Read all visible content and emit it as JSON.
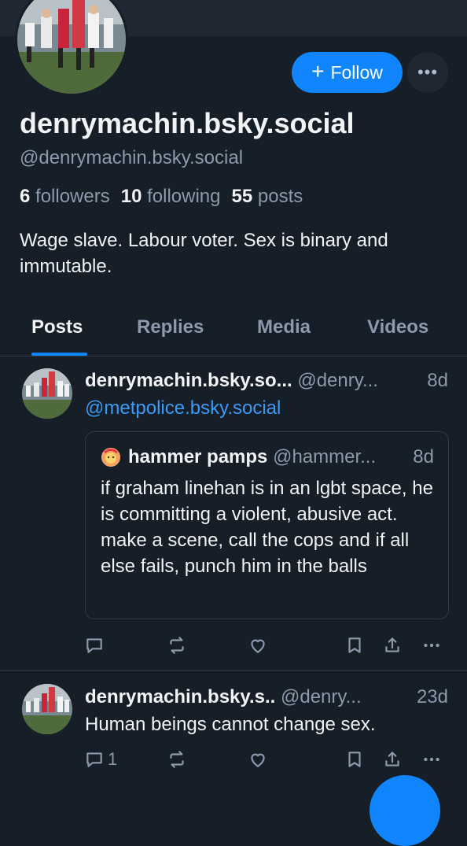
{
  "profile": {
    "display_name": "denrymachin.bsky.social",
    "handle": "@denrymachin.bsky.social",
    "followers_count": "6",
    "followers_label": "followers",
    "following_count": "10",
    "following_label": "following",
    "posts_count": "55",
    "posts_label": "posts",
    "bio": "Wage slave. Labour voter. Sex is binary and immutable."
  },
  "header": {
    "follow_plus": "+",
    "follow_label": "Follow",
    "more_label": "•••"
  },
  "tabs": [
    {
      "label": "Posts",
      "active": true
    },
    {
      "label": "Replies",
      "active": false
    },
    {
      "label": "Media",
      "active": false
    },
    {
      "label": "Videos",
      "active": false
    }
  ],
  "posts": [
    {
      "author": "denrymachin.bsky.so...",
      "handle": "@denry...",
      "time": "8d",
      "mention": "@metpolice.bsky.social",
      "quote": {
        "author": "hammer pamps",
        "handle": "@hammer...",
        "time": "8d",
        "text": "if graham linehan is in an lgbt space, he is committing a violent, abusive act. make a scene, call the cops and if all else fails, punch him in the balls"
      },
      "reply_count": ""
    },
    {
      "author": "denrymachin.bsky.s..",
      "handle": "@denry...",
      "time": "23d",
      "text": "Human beings cannot change sex.",
      "reply_count": "1"
    }
  ],
  "colors": {
    "background": "#161e27",
    "accent": "#1185fe",
    "muted_text": "#8c9aab",
    "link": "#3b9af8"
  },
  "icons": [
    "reply-icon",
    "repost-icon",
    "like-icon",
    "bookmark-icon",
    "share-icon",
    "more-icon"
  ]
}
